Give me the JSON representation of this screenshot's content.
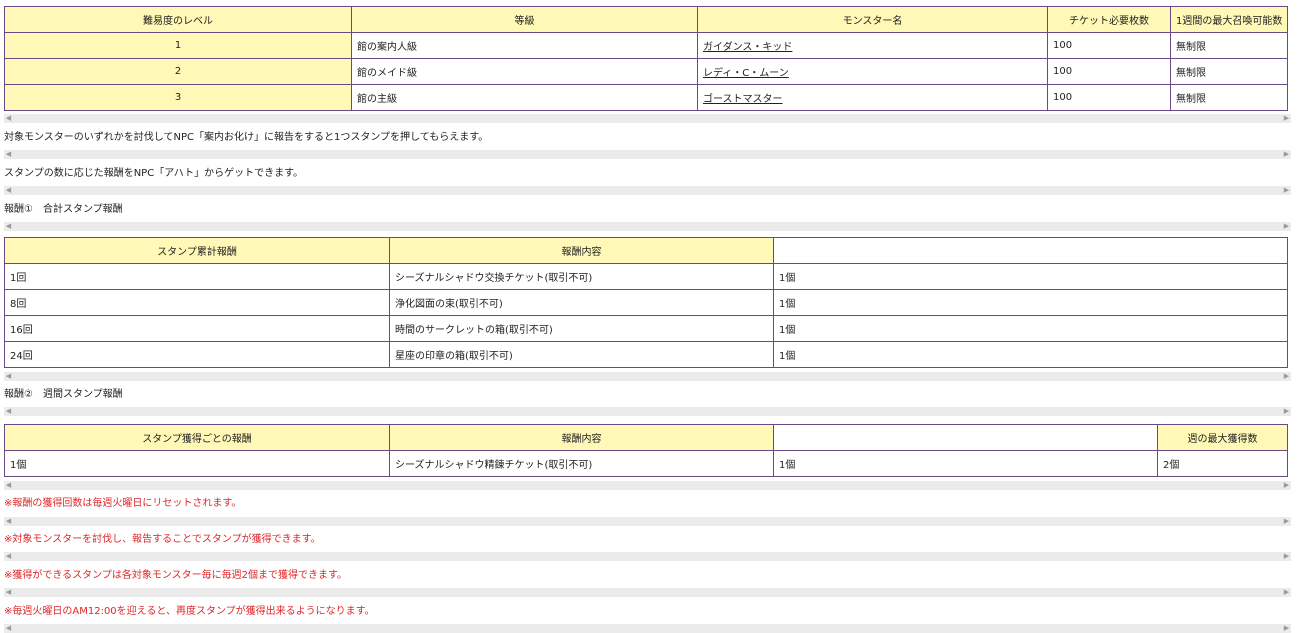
{
  "colors": {
    "header_fill": "#fff8b6",
    "border": "#6a4a86",
    "note_red": "#e0262a",
    "scrollbar": "#ebebeb"
  },
  "icons": {
    "scroll_left": "◀",
    "scroll_right": "▶"
  },
  "monster_table": {
    "headers": [
      "難易度のレベル",
      "等級",
      "モンスター名",
      "チケット必要枚数",
      "1週間の最大召喚可能数"
    ],
    "rows": [
      {
        "level": "1",
        "grade": "館の案内人級",
        "monster": "ガイダンス・キッド",
        "tickets": "100",
        "max": "無制限"
      },
      {
        "level": "2",
        "grade": "館のメイド級",
        "monster": "レディ・C・ムーン",
        "tickets": "100",
        "max": "無制限"
      },
      {
        "level": "3",
        "grade": "館の主級",
        "monster": "ゴーストマスター",
        "tickets": "100",
        "max": "無制限"
      }
    ]
  },
  "texts": {
    "line1": "対象モンスターのいずれかを討伐してNPC「案内お化け」に報告をすると1つスタンプを押してもらえます。",
    "line2": "スタンプの数に応じた報酬をNPC「アハト」からゲットできます。",
    "reward1_title": "報酬①　合計スタンプ報酬",
    "reward2_title": "報酬②　週間スタンプ報酬"
  },
  "total_table": {
    "headers": [
      "スタンプ累計報酬",
      "報酬内容",
      ""
    ],
    "rows": [
      {
        "count": "1回",
        "item": "シーズナルシャドウ交換チケット(取引不可)",
        "qty": "1個"
      },
      {
        "count": "8回",
        "item": "浄化図面の束(取引不可)",
        "qty": "1個"
      },
      {
        "count": "16回",
        "item": "時間のサークレットの箱(取引不可)",
        "qty": "1個"
      },
      {
        "count": "24回",
        "item": "星座の印章の箱(取引不可)",
        "qty": "1個"
      }
    ]
  },
  "weekly_table": {
    "headers": [
      "スタンプ獲得ごとの報酬",
      "報酬内容",
      "",
      "週の最大獲得数"
    ],
    "rows": [
      {
        "per": "1個",
        "item": "シーズナルシャドウ精錬チケット(取引不可)",
        "qty": "1個",
        "max": "2個"
      }
    ]
  },
  "notes": [
    "※報酬の獲得回数は毎週火曜日にリセットされます。",
    "※対象モンスターを討伐し、報告することでスタンプが獲得できます。",
    "※獲得ができるスタンプは各対象モンスター毎に毎週2個まで獲得できます。",
    "※毎週火曜日のAM12:00を迎えると、再度スタンプが獲得出来るようになります。"
  ]
}
